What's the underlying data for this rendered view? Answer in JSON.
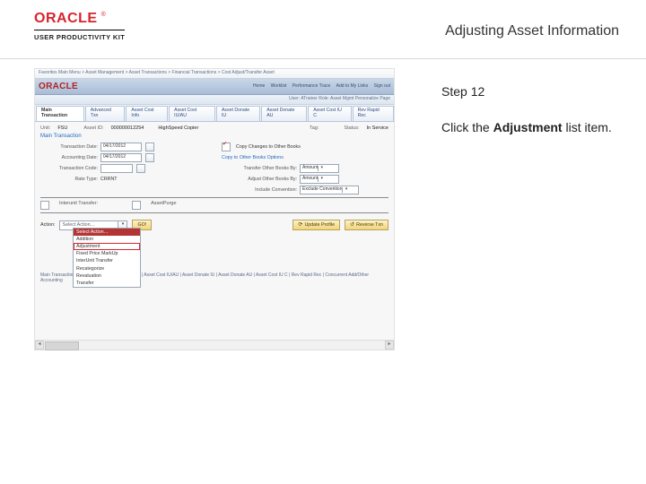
{
  "brand": {
    "logo_word": "ORACLE",
    "sub": "USER PRODUCTIVITY KIT"
  },
  "page_title": "Adjusting Asset Information",
  "step_label": "Step 12",
  "instruction_pre": "Click the ",
  "instruction_bold": "Adjustment",
  "instruction_post": " list item.",
  "app": {
    "breadcrumb_left": "Favorites   Main Menu > Asset Management > Asset Transactions > Financial Transactions > Cost Adjust/Transfer Asset",
    "breadcrumb_right": [
      "Home",
      "Worklist",
      "Performance Trace",
      "Add to My Links",
      "Sign out"
    ],
    "user_line": "User: ATrainer   Role: Asset Mgmt   Personalize Page",
    "tabs": [
      "Main Transaction",
      "Advanced Txn",
      "Asset Cost Info",
      "Asset Cost IU/AU",
      "Asset Donate IU",
      "Asset Donate AU",
      "Asset Cost IU C",
      "Rev Rapid Rec"
    ],
    "active_tab": 0,
    "unit_label": "Unit:",
    "unit_value": "FSU",
    "asset_label": "Asset ID:",
    "asset_value": "000000012254",
    "asset_desc": "HighSpeed Copier",
    "tag_label": "Tag:",
    "status_label": "Status:",
    "status_value": "In Service",
    "section_header": "Main Transaction",
    "transaction_date_label": "Transaction Date:",
    "transaction_date": "04/17/2012",
    "acctg_date_label": "Accounting Date:",
    "acctg_date": "04/17/2012",
    "trans_code_label": "Transaction Code:",
    "rate_type_label": "Rate Type:",
    "rate_type": "CRRNT",
    "copy_checkbox": "Copy Changes to Other Books",
    "copy_section_header": "Copy to Other Books Options",
    "transfer_label": "Transfer Other Books By:",
    "transfer_value": "Amount",
    "adjust_label": "Adjust Other Books By:",
    "adjust_value": "Amount",
    "include_label": "Include Convention:",
    "include_value": "Exclude Convention",
    "interunit_row_left": "Interunit Transfer:",
    "interunit_row_right": "AssetPurge",
    "action_label": "Action:",
    "action_value": "Select Action…",
    "go_btn": "GO!",
    "update_btn": "Update Profile",
    "reverse_btn": "Reverse Txn",
    "dropdown": {
      "header": "Select Action…",
      "items": [
        "Addition",
        "Adjustment",
        "Fixed Price MarkUp",
        "InterUnit Transfer",
        "Recategorize",
        "Revaluation",
        "Transfer"
      ]
    },
    "footer_links": "Main Transaction | Advanced Txn | Asset Cost Info | Asset Cost IU/AU | Asset Donate IU | Asset Donate AU | Asset Cost IU C | Rev Rapid Rec | Concurrent Add/Other Accounting"
  },
  "colors": {
    "brand": "#d9232e"
  }
}
